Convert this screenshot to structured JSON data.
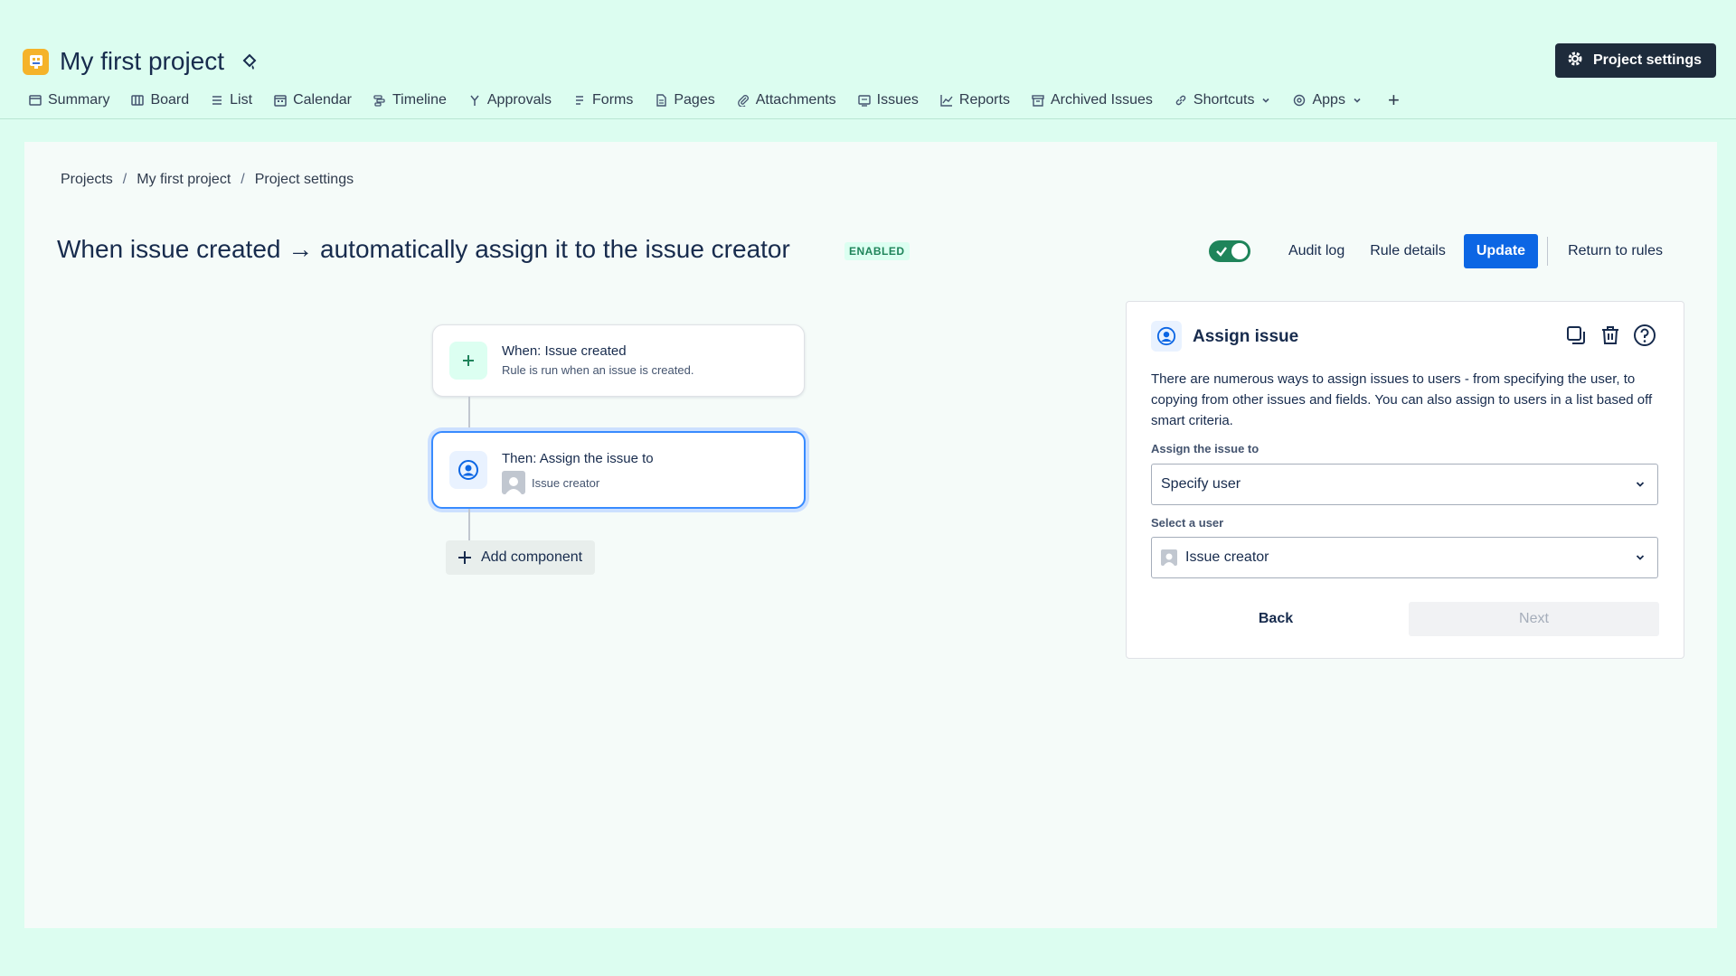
{
  "project": {
    "title": "My first project"
  },
  "header": {
    "settings_label": "Project settings"
  },
  "nav": {
    "items": [
      {
        "label": "Summary",
        "icon": "summary-icon"
      },
      {
        "label": "Board",
        "icon": "board-icon"
      },
      {
        "label": "List",
        "icon": "list-icon"
      },
      {
        "label": "Calendar",
        "icon": "calendar-icon"
      },
      {
        "label": "Timeline",
        "icon": "timeline-icon"
      },
      {
        "label": "Approvals",
        "icon": "approvals-icon"
      },
      {
        "label": "Forms",
        "icon": "forms-icon"
      },
      {
        "label": "Pages",
        "icon": "pages-icon"
      },
      {
        "label": "Attachments",
        "icon": "attachments-icon"
      },
      {
        "label": "Issues",
        "icon": "issues-icon"
      },
      {
        "label": "Reports",
        "icon": "reports-icon"
      },
      {
        "label": "Archived Issues",
        "icon": "archive-icon"
      },
      {
        "label": "Shortcuts",
        "icon": "link-icon"
      },
      {
        "label": "Apps",
        "icon": "apps-icon"
      }
    ],
    "plus": "+"
  },
  "breadcrumb": {
    "items": [
      "Projects",
      "My first project",
      "Project settings"
    ],
    "separator": "/"
  },
  "rule": {
    "title": "When issue created → automatically assign it to the issue creator",
    "status": "ENABLED",
    "enabled": true
  },
  "toolbar": {
    "audit_log": "Audit log",
    "rule_details": "Rule details",
    "update": "Update",
    "return": "Return to rules"
  },
  "flow": {
    "trigger": {
      "title": "When: Issue created",
      "subtitle": "Rule is run when an issue is created."
    },
    "action": {
      "title": "Then: Assign the issue to",
      "subtitle": "Issue creator"
    },
    "add_component": "Add component"
  },
  "panel": {
    "title": "Assign issue",
    "description": "There are numerous ways to assign issues to users - from specifying the user, to copying from other issues and fields. You can also assign to users in a list based off smart criteria.",
    "assign_label": "Assign the issue to",
    "assign_value": "Specify user",
    "user_label": "Select a user",
    "user_value": "Issue creator",
    "back": "Back",
    "next": "Next"
  },
  "colors": {
    "background": "#dcfdf0",
    "primary": "#0c66e4",
    "success": "#1f845a",
    "dark_button": "#1e2b3b"
  }
}
